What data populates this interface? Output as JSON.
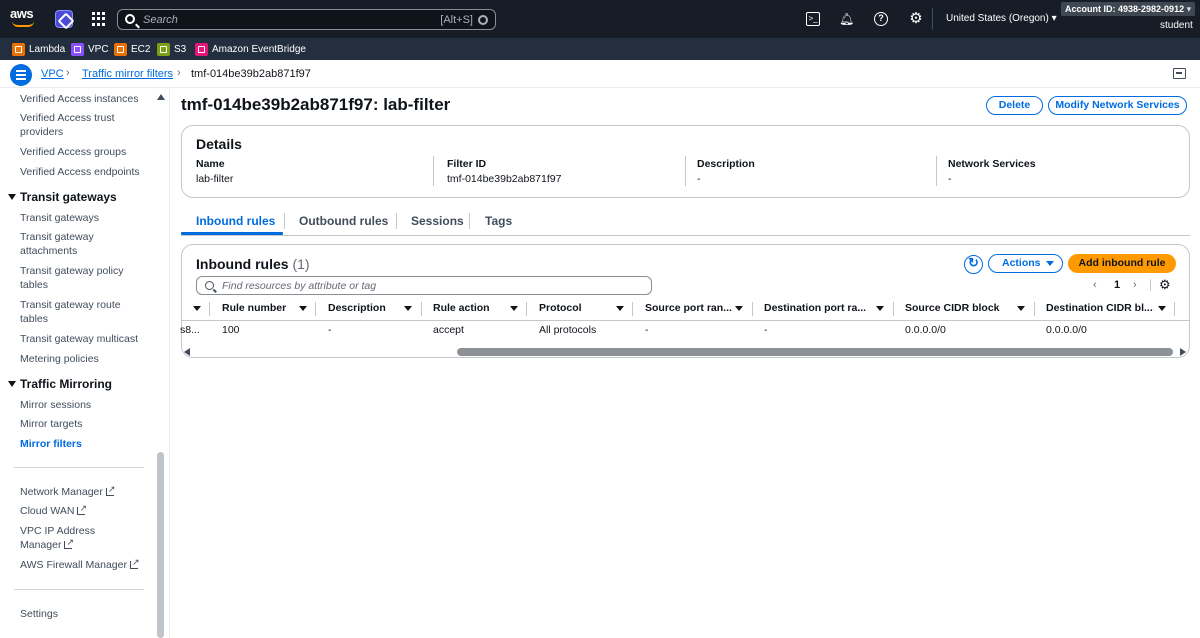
{
  "topnav": {
    "logo": "aws",
    "search_placeholder": "Search",
    "search_shortcut": "[Alt+S]",
    "region": "United States (Oregon)",
    "account_label": "Account ID:",
    "account_id": "4938-2982-0912",
    "user": "student",
    "icons": [
      "cloudshell-icon",
      "bell-icon",
      "help-icon",
      "gear-icon"
    ]
  },
  "favorites": [
    {
      "label": "Lambda",
      "color": "#ed7100"
    },
    {
      "label": "VPC",
      "color": "#8c4fff"
    },
    {
      "label": "EC2",
      "color": "#ed7100"
    },
    {
      "label": "S3",
      "color": "#7aa116"
    },
    {
      "label": "Amazon EventBridge",
      "color": "#e7157b"
    }
  ],
  "breadcrumb": {
    "items": [
      "VPC",
      "Traffic mirror filters",
      "tmf-014be39b2ab871f97"
    ]
  },
  "sidebar": {
    "items_top": [
      "Verified Access instances",
      "Verified Access trust providers",
      "Verified Access groups",
      "Verified Access endpoints"
    ],
    "transit_header": "Transit gateways",
    "transit_items": [
      "Transit gateways",
      "Transit gateway attachments",
      "Transit gateway policy tables",
      "Transit gateway route tables",
      "Transit gateway multicast",
      "Metering policies"
    ],
    "mirror_header": "Traffic Mirroring",
    "mirror_items": [
      "Mirror sessions",
      "Mirror targets",
      "Mirror filters"
    ],
    "external_items": [
      "Network Manager",
      "Cloud WAN",
      "VPC IP Address Manager",
      "AWS Firewall Manager"
    ],
    "settings": "Settings"
  },
  "page": {
    "title": "tmf-014be39b2ab871f97: lab-filter",
    "delete_label": "Delete",
    "modify_label": "Modify Network Services"
  },
  "details": {
    "title": "Details",
    "fields": [
      {
        "label": "Name",
        "value": "lab-filter"
      },
      {
        "label": "Filter ID",
        "value": "tmf-014be39b2ab871f97"
      },
      {
        "label": "Description",
        "value": "-"
      },
      {
        "label": "Network Services",
        "value": "-"
      }
    ]
  },
  "tabs": [
    "Inbound rules",
    "Outbound rules",
    "Sessions",
    "Tags"
  ],
  "rules": {
    "title": "Inbound rules",
    "count": "(1)",
    "actions_label": "Actions",
    "add_label": "Add inbound rule",
    "filter_placeholder": "Find resources by attribute or tag",
    "page": "1",
    "columns": [
      "Rule number",
      "Description",
      "Rule action",
      "Protocol",
      "Source port ran...",
      "Destination port ra...",
      "Source CIDR block",
      "Destination CIDR bl..."
    ],
    "rows": [
      {
        "id": "s8...",
        "cells": [
          "100",
          "-",
          "accept",
          "All protocols",
          "-",
          "-",
          "0.0.0.0/0",
          "0.0.0.0/0"
        ]
      }
    ]
  }
}
